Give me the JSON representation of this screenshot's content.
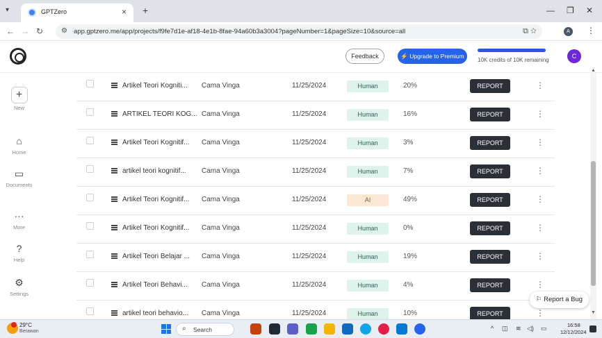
{
  "browser": {
    "tab_title": "GPTZero",
    "url": "app.gptzero.me/app/projects/f9fe7d1e-af18-4e1b-8fae-94a60b3a3004?pageNumber=1&pageSize=10&source=all",
    "profile_initial": "A"
  },
  "header": {
    "feedback_label": "Feedback",
    "premium_label": "⚡ Upgrade to Premium",
    "credits_text": "10K credits of 10K remaining",
    "credits_fraction": 1.0,
    "avatar_initial": "C"
  },
  "sidebar": {
    "items": [
      {
        "label": "New",
        "icon": "plus-icon"
      },
      {
        "label": "Home",
        "icon": "home-icon"
      },
      {
        "label": "Documents",
        "icon": "folder-icon"
      },
      {
        "label": "More",
        "icon": "ellipsis-icon"
      },
      {
        "label": "Help",
        "icon": "help-icon"
      },
      {
        "label": "Settings",
        "icon": "gear-icon"
      }
    ]
  },
  "table": {
    "report_label": "REPORT",
    "rows": [
      {
        "name": "Artikel Teori Kogniti...",
        "author": "Cama Vinga",
        "date": "11/25/2024",
        "result": "Human",
        "percent": "20%"
      },
      {
        "name": "ARTIKEL TEORI KOG...",
        "author": "Cama Vinga",
        "date": "11/25/2024",
        "result": "Human",
        "percent": "16%"
      },
      {
        "name": "Artikel Teori Kognitif...",
        "author": "Cama Vinga",
        "date": "11/25/2024",
        "result": "Human",
        "percent": "3%"
      },
      {
        "name": "artikel teori kognitif...",
        "author": "Cama Vinga",
        "date": "11/25/2024",
        "result": "Human",
        "percent": "7%"
      },
      {
        "name": "Artikel Teori Kognitif...",
        "author": "Cama Vinga",
        "date": "11/25/2024",
        "result": "AI",
        "percent": "49%"
      },
      {
        "name": "Artikel Teori Kognitif...",
        "author": "Cama Vinga",
        "date": "11/25/2024",
        "result": "Human",
        "percent": "0%"
      },
      {
        "name": "Artikel Teori Belajar ...",
        "author": "Cama Vinga",
        "date": "11/25/2024",
        "result": "Human",
        "percent": "19%"
      },
      {
        "name": "Artikel Teori Behavi...",
        "author": "Cama Vinga",
        "date": "11/25/2024",
        "result": "Human",
        "percent": "4%"
      },
      {
        "name": "artikel teori behavio...",
        "author": "Cama Vinga",
        "date": "11/25/2024",
        "result": "Human",
        "percent": "10%"
      }
    ]
  },
  "report_bug_label": "Report a Bug",
  "taskbar": {
    "weather_temp": "29°C",
    "weather_condition": "Berawan",
    "search_label": "Search",
    "time": "16:58",
    "date": "12/12/2024"
  },
  "colors": {
    "accent": "#2563eb",
    "human_badge": "#dff3ed",
    "ai_badge": "#fde7d5",
    "report_button": "#2b2f36",
    "avatar": "#6d28d9"
  }
}
